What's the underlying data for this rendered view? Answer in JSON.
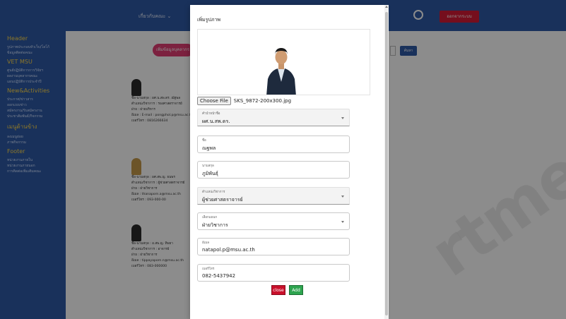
{
  "bg": {
    "header_menu": "เกี่ยวกับคณะ ⌄",
    "logout_label": "ออกจากระบบ",
    "add_btn": "เพิ่มข้อมูลบุคลากร",
    "search_btn": "ค้นหา",
    "sidebar": [
      {
        "heading": "Header",
        "links": [
          "รูปภาพประกอบหัวเว็บ/โลโก้",
          "ข้อมูลติดต่อคณะ"
        ]
      },
      {
        "heading": "VET MSU",
        "links": [
          "ศูนย์ปฏิบัติการการวิจัยฯ",
          "ผลงานบุคลากรคณะ",
          "แผนปฏิบัติการประจำปี"
        ]
      },
      {
        "heading": "New&Activities",
        "links": [
          "ประกาศ/ข่าวสาร",
          "ออกแบบข่าว",
          "สมัครงาน/รับสมัครงาน",
          "ประชาสัมพันธ์/กิจกรรม"
        ]
      },
      {
        "heading": "เมนูด้านข้าง",
        "links": [
          "ลงเมนูย่อย",
          "ภาพกิจกรรม"
        ]
      },
      {
        "heading": "Footer",
        "links": [
          "หน่วยงานภายใน",
          "หน่วยงานภายนอก",
          "การติดต่อเพิ่มเติมคณะ"
        ]
      }
    ],
    "cards": [
      {
        "name": "ชื่อ-นามสกุล : ผศ.น.สพ.ดร. ณัฐพล",
        "position": "ตำแหน่งวิชาการ : รองศาสตราจารย์",
        "dept": "ฝ่าย : ฝ่ายบริหาร",
        "email": "อีเมล : E-mail : pongphol.p@msu.ac.th",
        "phone": "เบอร์โทร : 0816266634"
      },
      {
        "name": "ชื่อ-นามสกุล : ผศ.สพ.ญ. ธนพร",
        "position": "ตำแหน่งวิชาการ : ผู้ช่วยศาสตราจารย์",
        "dept": "ฝ่าย : ฝ่ายวิชาการ",
        "email": "อีเมล : thanaporn.a@msu.ac.th",
        "phone": "เบอร์โทร : 093-000-00"
      },
      {
        "name": "ชื่อ-นามสกุล : อ.สพ.ญ. ทิพยา",
        "position": "ตำแหน่งวิชาการ : อาจารย์",
        "dept": "ฝ่าย : ฝ่ายวิชาการ",
        "email": "อีเมล : tippayaporn.n@msu.ac.th",
        "phone": "เบอร์โทร : 083-000000"
      }
    ],
    "watermark": "rtme"
  },
  "modal": {
    "title": "เพิ่มรูปภาพ",
    "choose_file": "Choose File",
    "file_name": "SKS_9872-200x300.jpg",
    "fields": {
      "prefix": {
        "label": "คำนำหน้าชื่อ",
        "value": "ผศ.น.สพ.ดร."
      },
      "first_name": {
        "label": "ชื่อ",
        "value": "ณฐพล"
      },
      "last_name": {
        "label": "นามสกุล",
        "value": "ภูมิพันธุ์"
      },
      "academic_position": {
        "label": "ตำแหน่งวิชาการ",
        "value": "ผู้ช่วยศาสตราจารย์"
      },
      "department": {
        "label": "เลือกแผนก",
        "value": "ฝ่ายวิชาการ"
      },
      "email": {
        "label": "อีเมล",
        "value": "natapol.p@msu.ac.th"
      },
      "phone": {
        "label": "เบอร์โทร",
        "value": "082-5437942"
      }
    },
    "close_label": "close",
    "add_label": "Add"
  },
  "colors": {
    "header_blue": "#2f5aa6",
    "close_red": "#c9102b",
    "add_green": "#2ea44f",
    "logout_red": "#d61b35"
  }
}
